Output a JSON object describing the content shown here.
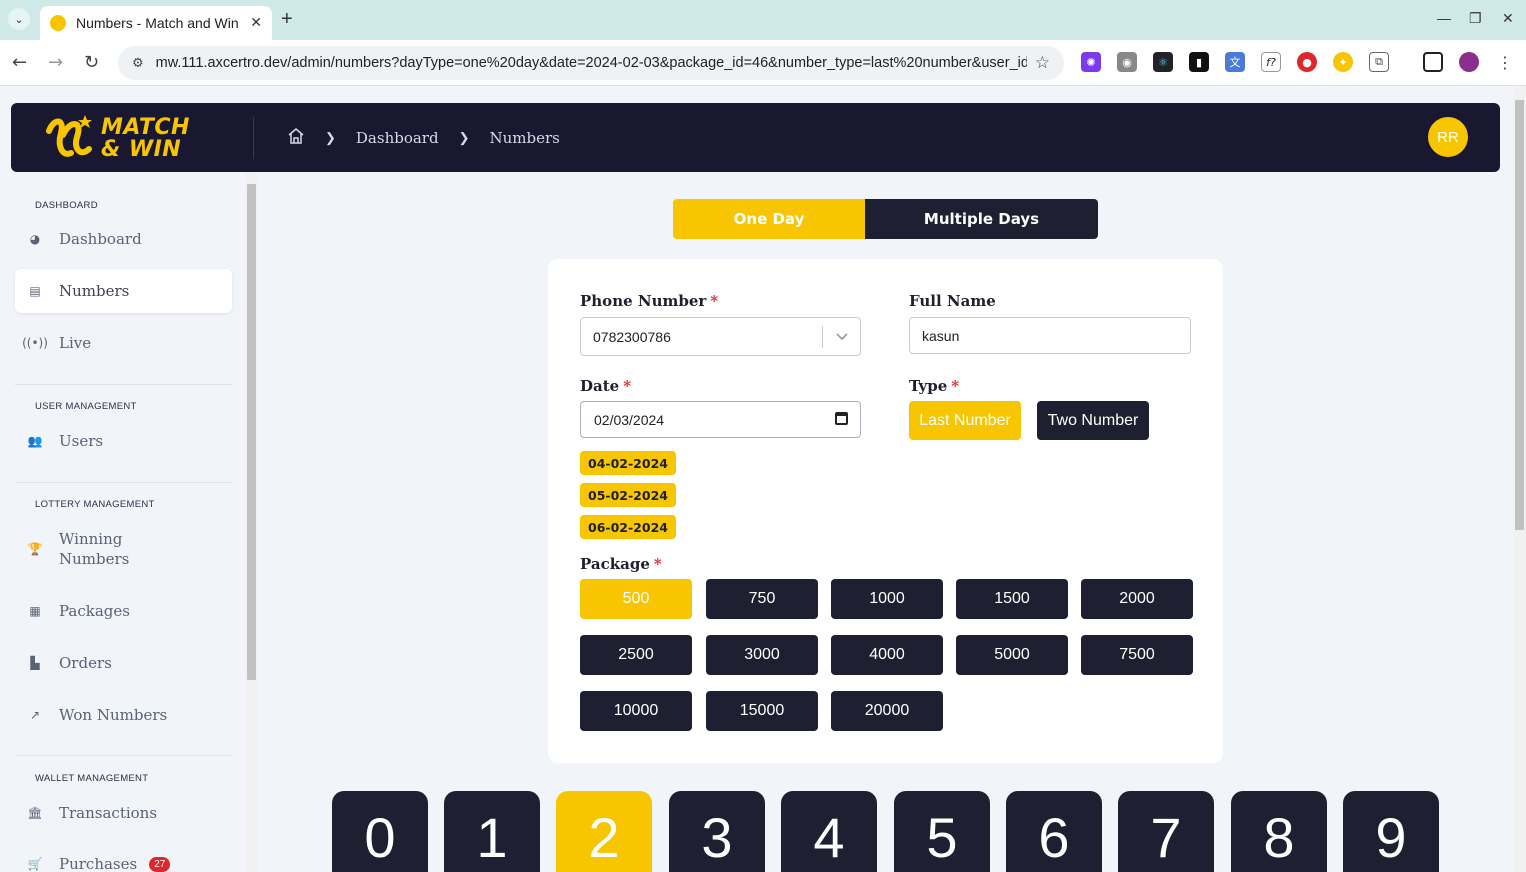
{
  "browser": {
    "tab_title": "Numbers - Match and Win",
    "url": "mw.111.axcertro.dev/admin/numbers?dayType=one%20day&date=2024-02-03&package_id=46&number_type=last%20number&user_id..."
  },
  "header": {
    "logo_line1": "MATCH",
    "logo_line2": "& WIN",
    "breadcrumb": [
      "Dashboard",
      "Numbers"
    ],
    "avatar_initials": "RR"
  },
  "sidebar": {
    "sections": [
      "DASHBOARD",
      "USER MANAGEMENT",
      "LOTTERY MANAGEMENT",
      "WALLET MANAGEMENT"
    ],
    "items": [
      {
        "label": "Dashboard",
        "icon": "pie-chart-icon"
      },
      {
        "label": "Numbers",
        "icon": "ticket-icon"
      },
      {
        "label": "Live",
        "icon": "broadcast-icon"
      },
      {
        "label": "Users",
        "icon": "users-icon"
      },
      {
        "label": "Winning Numbers",
        "icon": "trophy-icon"
      },
      {
        "label": "Packages",
        "icon": "grid-icon"
      },
      {
        "label": "Orders",
        "icon": "orders-icon"
      },
      {
        "label": "Won Numbers",
        "icon": "trend-icon"
      },
      {
        "label": "Transactions",
        "icon": "bank-icon"
      },
      {
        "label": "Purchases",
        "icon": "cart-icon",
        "badge": "27"
      }
    ]
  },
  "day_toggle": {
    "one_day": "One Day",
    "multiple_days": "Multiple Days",
    "selected": "One Day"
  },
  "form": {
    "phone_label": "Phone Number",
    "phone_value": "0782300786",
    "full_name_label": "Full Name",
    "full_name_value": "kasun",
    "date_label": "Date",
    "date_value": "02/03/2024",
    "date_chips": [
      "04-02-2024",
      "05-02-2024",
      "06-02-2024"
    ],
    "type_label": "Type",
    "type_options": [
      "Last Number",
      "Two Number"
    ],
    "type_selected": "Last Number",
    "package_label": "Package",
    "packages": [
      "500",
      "750",
      "1000",
      "1500",
      "2000",
      "2500",
      "3000",
      "4000",
      "5000",
      "7500",
      "10000",
      "15000",
      "20000"
    ],
    "package_selected": "500",
    "required_mark": "*"
  },
  "digits": {
    "values": [
      "0",
      "1",
      "2",
      "3",
      "4",
      "5",
      "6",
      "7",
      "8",
      "9"
    ],
    "selected": "2"
  },
  "colors": {
    "accent": "#f7c600",
    "dark": "#1e2032",
    "header_bg": "#1a1830",
    "badge": "#e0262d"
  }
}
